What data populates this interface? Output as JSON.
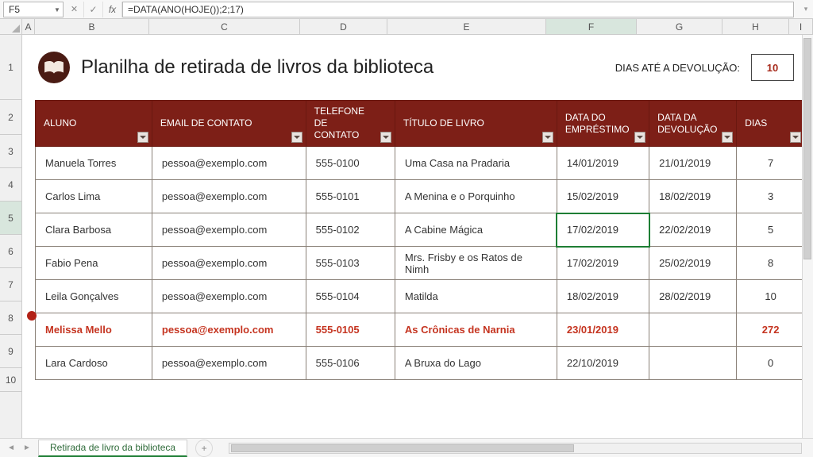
{
  "formula_bar": {
    "cell_ref": "F5",
    "fx_label": "fx",
    "formula": "=DATA(ANO(HOJE());2;17)"
  },
  "columns": [
    "A",
    "B",
    "C",
    "D",
    "E",
    "F",
    "G",
    "H",
    "I"
  ],
  "active_column": "F",
  "row_numbers": [
    "1",
    "2",
    "3",
    "4",
    "5",
    "6",
    "7",
    "8",
    "9",
    "10"
  ],
  "active_row": "5",
  "header": {
    "title": "Planilha de retirada de livros da biblioteca",
    "days_label": "DIAS ATÉ A DEVOLUÇÃO:",
    "days_value": "10"
  },
  "table": {
    "headers": {
      "aluno": "ALUNO",
      "email": "EMAIL DE CONTATO",
      "telefone": "TELEFONE DE CONTATO",
      "titulo": "TÍTULO DE LIVRO",
      "emprestimo": "DATA DO EMPRÉSTIMO",
      "devolucao": "DATA DA DEVOLUÇÃO",
      "dias": "DIAS"
    },
    "rows": [
      {
        "aluno": "Manuela Torres",
        "email": "pessoa@exemplo.com",
        "tel": "555-0100",
        "titulo": "Uma Casa na Pradaria",
        "emp": "14/01/2019",
        "dev": "21/01/2019",
        "dias": "7",
        "hl": false
      },
      {
        "aluno": "Carlos Lima",
        "email": "pessoa@exemplo.com",
        "tel": "555-0101",
        "titulo": "A Menina e o Porquinho",
        "emp": "15/02/2019",
        "dev": "18/02/2019",
        "dias": "3",
        "hl": false
      },
      {
        "aluno": "Clara Barbosa",
        "email": "pessoa@exemplo.com",
        "tel": "555-0102",
        "titulo": "A Cabine Mágica",
        "emp": "17/02/2019",
        "dev": "22/02/2019",
        "dias": "5",
        "hl": false
      },
      {
        "aluno": "Fabio Pena",
        "email": "pessoa@exemplo.com",
        "tel": "555-0103",
        "titulo": "Mrs. Frisby e os Ratos de Nimh",
        "emp": "17/02/2019",
        "dev": "25/02/2019",
        "dias": "8",
        "hl": false
      },
      {
        "aluno": "Leila Gonçalves",
        "email": "pessoa@exemplo.com",
        "tel": "555-0104",
        "titulo": "Matilda",
        "emp": "18/02/2019",
        "dev": "28/02/2019",
        "dias": "10",
        "hl": false
      },
      {
        "aluno": "Melissa Mello",
        "email": "pessoa@exemplo.com",
        "tel": "555-0105",
        "titulo": "As Crônicas de Narnia",
        "emp": "23/01/2019",
        "dev": "",
        "dias": "272",
        "hl": true
      },
      {
        "aluno": "Lara Cardoso",
        "email": "pessoa@exemplo.com",
        "tel": "555-0106",
        "titulo": "A Bruxa do Lago",
        "emp": "22/10/2019",
        "dev": "",
        "dias": "0",
        "hl": false
      }
    ],
    "active_cell_row_index": 2
  },
  "tabs": {
    "active": "Retirada de livro da biblioteca",
    "add": "+"
  }
}
